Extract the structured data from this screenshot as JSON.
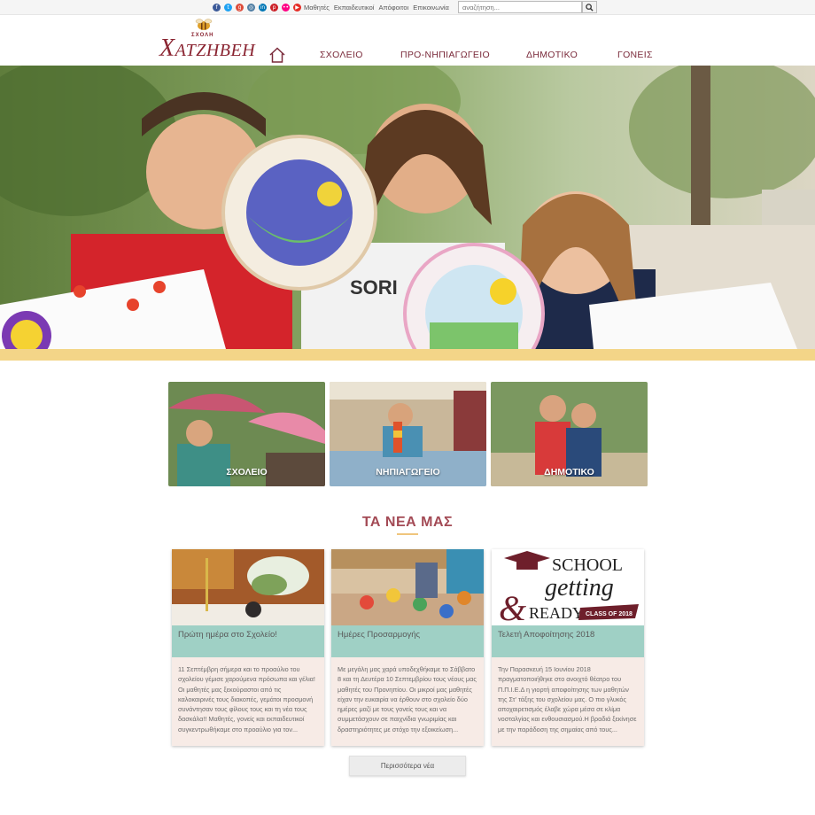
{
  "topbar": {
    "social_icons": [
      {
        "name": "facebook-icon",
        "glyph": "f",
        "color": "#3b5998"
      },
      {
        "name": "twitter-icon",
        "glyph": "t",
        "color": "#1da1f2"
      },
      {
        "name": "google-plus-icon",
        "glyph": "g",
        "color": "#dd4b39"
      },
      {
        "name": "instagram-icon",
        "glyph": "◎",
        "color": "#517fa4"
      },
      {
        "name": "linkedin-icon",
        "glyph": "in",
        "color": "#0077b5"
      },
      {
        "name": "pinterest-icon",
        "glyph": "p",
        "color": "#cb2027"
      },
      {
        "name": "flickr-icon",
        "glyph": "••",
        "color": "#ff0084"
      },
      {
        "name": "youtube-icon",
        "glyph": "▶",
        "color": "#e52d27"
      }
    ],
    "links": [
      "Μαθητές",
      "Εκπαιδευτικοί",
      "Απόφοιτοι",
      "Επικοινωνία"
    ],
    "search_placeholder": "αναζήτηση..."
  },
  "header": {
    "logo_small": "ΣΧΟΛΗ",
    "logo_first": "Χ",
    "logo_rest": "ΑΤΖΗΒΕΗ",
    "nav": [
      "ΣΧΟΛΕΙΟ",
      "ΠΡΟ-ΝΗΠΙΑΓΩΓΕΙΟ",
      "ΔΗΜΟΤΙΚΟ",
      "ΓΟΝΕΙΣ"
    ]
  },
  "categories": [
    {
      "label": "ΣΧΟΛΕΙΟ"
    },
    {
      "label": "ΝΗΠΙΑΓΩΓΕΙΟ"
    },
    {
      "label": "ΔΗΜΟΤΙΚΟ"
    }
  ],
  "news": {
    "title": "ΤΑ ΝΕΑ ΜΑΣ",
    "items": [
      {
        "title": "Πρώτη ημέρα στο Σχολείο!",
        "body": "11 Σεπτέμβρη σήμερα και το προαύλιο του σχολείου γέμισε χαρούμενα πρόσωπα και γέλια!Οι μαθητές μας ξεκούραστοι από τις καλοκαιρινές τους διακοπές, γεμάτοι προσμονή συνάντησαν τους φίλους τους και τη νέα τους δασκάλα!! Μαθητές, γονείς και εκπαιδευτικοί συγκεντρωθήκαμε στο προαύλιο για τον..."
      },
      {
        "title": "Ημέρες Προσαρμογής",
        "body": "Με μεγάλη μας χαρά υποδεχθήκαμε το Σάββατο 8 και τη Δευτέρα 10 Σεπτεμβρίου τους νέους μας μαθητές του Προνηπίου. Οι μικροί μας μαθητές είχαν την ευκαιρία να έρθουν στο σχολείο δύο ημέρες μαζί με τους γονείς τους και να συμμετάσχουν σε παιχνίδια γνωριμίας και δραστηριότητες με στόχο την εξοικείωση..."
      },
      {
        "title": "Τελετή Αποφοίτησης 2018",
        "body": "Την Παρασκευή 15 Ιουνίου 2018 πραγματοποιήθηκε στο ανοιχτό θέατρο του Π.Π.Ι.Ε.Δ η γιορτή αποφοίτησης των μαθητών της Στ' τάξης του σχολείου μας. Ο πιο γλυκός αποχαιρετισμός έλαβε χώρα μέσα σε κλίμα νοσταλγίας και ενθουσιασμού.Η βραδιά ξεκίνησε με την παράδοση της σημαίας από τους..."
      }
    ],
    "graduation_image": {
      "line1": "SCHOOL",
      "line2": "getting",
      "amp": "&",
      "line3": "READY",
      "ribbon": "CLASS OF 2018"
    },
    "more_button": "Περισσότερα νέα"
  },
  "colors": {
    "brand": "#8a2431",
    "nav": "#7a2a3a",
    "news_title": "#a34a55",
    "stripe": "#f3d588",
    "card_head": "#9fd0c5",
    "card_body": "#f7ebe6"
  }
}
